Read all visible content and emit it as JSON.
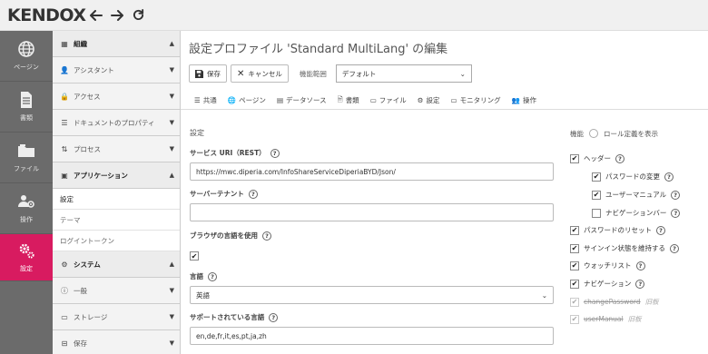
{
  "app": {
    "logo": "KENDOX"
  },
  "rail": [
    {
      "label": "ページン",
      "icon": "globe-icon",
      "active": false
    },
    {
      "label": "書類",
      "icon": "document-icon",
      "active": false
    },
    {
      "label": "ファイル",
      "icon": "folder-icon",
      "active": false
    },
    {
      "label": "操作",
      "icon": "users-gear-icon",
      "active": false
    },
    {
      "label": "設定",
      "icon": "settings-gear-icon",
      "active": true
    }
  ],
  "sidebar": {
    "sections": [
      {
        "label": "組織",
        "open": true,
        "head": true
      },
      {
        "label": "アシスタント",
        "open": false
      },
      {
        "label": "アクセス",
        "open": false
      },
      {
        "label": "ドキュメントのプロパティ",
        "open": false
      },
      {
        "label": "プロセス",
        "open": false
      },
      {
        "label": "アプリケーション",
        "open": true,
        "head": true
      },
      {
        "label": "システム",
        "open": true,
        "head": true
      },
      {
        "label": "一般",
        "open": false
      },
      {
        "label": "ストレージ",
        "open": false
      },
      {
        "label": "保存",
        "open": false
      }
    ],
    "app_items": [
      "設定",
      "テーマ",
      "ログイントークン"
    ]
  },
  "main": {
    "title": "設定プロファイル 'Standard MultiLang' の編集",
    "toolbar": {
      "save": "保存",
      "cancel": "キャンセル",
      "scope_label": "機能範囲",
      "scope_value": "デフォルト"
    },
    "tabs": [
      "共通",
      "ページン",
      "データソース",
      "書類",
      "ファイル",
      "設定",
      "モニタリング",
      "操作"
    ],
    "section_title": "設定",
    "fields": {
      "service_uri_label": "サービス URI（REST）",
      "service_uri_value": "https://mwc.diperia.com/InfoShareServiceDiperiaBYD/Json/",
      "tenant_label": "サーバーテナント",
      "tenant_value": "",
      "browser_lang_label": "ブラウザの言語を使用",
      "browser_lang_checked": true,
      "language_label": "言語",
      "language_value": "英語",
      "supported_label": "サポートされている言語",
      "supported_value": "en,de,fr,it,es,pt,ja,zh"
    },
    "features": {
      "title": "機能",
      "role_label": "ロール定義を表示",
      "items": [
        {
          "label": "ヘッダー",
          "checked": true,
          "indent": false,
          "help": true,
          "disabled": false
        },
        {
          "label": "パスワードの変更",
          "checked": true,
          "indent": true,
          "help": true,
          "disabled": false
        },
        {
          "label": "ユーザーマニュアル",
          "checked": true,
          "indent": true,
          "help": true,
          "disabled": false
        },
        {
          "label": "ナビゲーションバー",
          "checked": false,
          "indent": true,
          "help": true,
          "disabled": false
        },
        {
          "label": "パスワードのリセット",
          "checked": true,
          "indent": false,
          "help": true,
          "disabled": false
        },
        {
          "label": "サインイン状態を維持する",
          "checked": true,
          "indent": false,
          "help": true,
          "disabled": false
        },
        {
          "label": "ウォッチリスト",
          "checked": true,
          "indent": false,
          "help": true,
          "disabled": false
        },
        {
          "label": "ナビゲーション",
          "checked": true,
          "indent": false,
          "help": true,
          "disabled": false
        },
        {
          "label": "changePassword",
          "note": "旧板",
          "checked": true,
          "indent": false,
          "help": false,
          "disabled": true
        },
        {
          "label": "userManual",
          "note": "旧板",
          "checked": true,
          "indent": false,
          "help": false,
          "disabled": true
        }
      ]
    }
  }
}
